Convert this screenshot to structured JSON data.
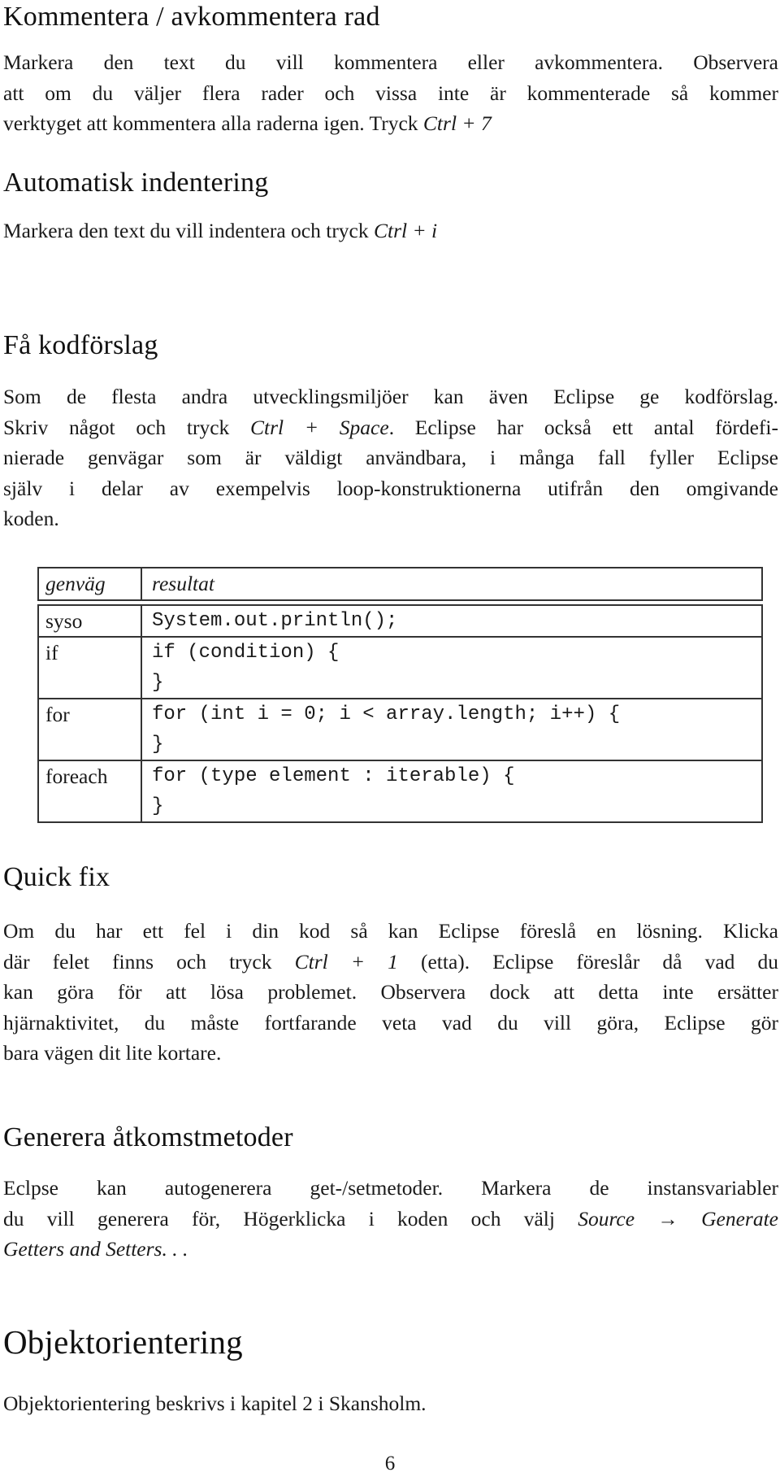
{
  "sections": [
    {
      "heading": "Kommentera / avkommentera rad",
      "lines": [
        "Markera den text du vill kommentera eller avkommentera. Observera",
        "att om du väljer flera rader och vissa inte är kommenterade så kommer"
      ],
      "last_line_prefix": "verktyget att kommentera alla raderna igen. Tryck ",
      "shortcut": "Ctrl + 7"
    },
    {
      "heading": "Automatisk indentering",
      "last_line_prefix": "Markera den text du vill indentera och tryck ",
      "shortcut": "Ctrl + i"
    },
    {
      "heading": "Få kodförslag",
      "line1": "Som de flesta andra utvecklingsmiljöer kan även Eclipse ge kodförslag.",
      "line2_prefix": "Skriv något och tryck ",
      "shortcut": "Ctrl + Space",
      "line2_suffix": ". Eclipse har också ett antal fördefi-",
      "line3": "nierade genvägar som är väldigt användbara, i många fall fyller Eclipse",
      "line4": "själv i delar av exempelvis loop-konstruktionerna utifrån den omgivande",
      "line5": "koden."
    },
    {
      "heading": "Quick fix",
      "line1": "Om du har ett fel i din kod så kan Eclipse föreslå en lösning. Klicka",
      "line2_prefix": "där felet finns och tryck ",
      "shortcut": "Ctrl + 1",
      "line2_suffix": " (etta). Eclipse föreslår då vad du",
      "line3": "kan göra för att lösa problemet. Observera dock att detta inte ersätter",
      "line4": "hjärnaktivitet, du måste fortfarande veta vad du vill göra, Eclipse gör",
      "line5": "bara vägen dit lite kortare."
    },
    {
      "heading": "Generera åtkomstmetoder",
      "line1": "Eclpse kan autogenerera get-/setmetoder. Markera de instansvariabler",
      "line2_prefix": "du vill generera för, Högerklicka i koden och välj ",
      "menu_source": "Source",
      "arrow": "→",
      "menu_generate": "Generate",
      "line3": "Getters and Setters. . ."
    },
    {
      "heading": "Objektorientering",
      "line1": "Objektorientering beskrivs i kapitel 2 i Skansholm."
    }
  ],
  "shortcut_table": {
    "headers": [
      "genväg",
      "resultat"
    ],
    "rows": [
      {
        "shortcut": "syso",
        "code": [
          "System.out.println();"
        ]
      },
      {
        "shortcut": "if",
        "code": [
          "if (condition) {",
          "}"
        ]
      },
      {
        "shortcut": "for",
        "code": [
          "for (int i = 0; i < array.length; i++) {",
          "}"
        ]
      },
      {
        "shortcut": "foreach",
        "code": [
          "for (type element : iterable) {",
          "}"
        ]
      }
    ]
  },
  "page_number": "6"
}
